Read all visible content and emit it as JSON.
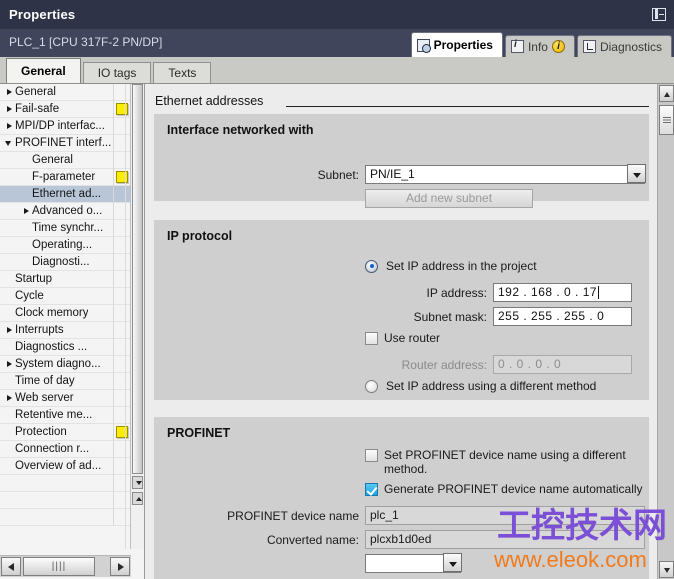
{
  "window": {
    "title": "Properties",
    "dock_icon": "dock-layout-icon"
  },
  "device_header": {
    "name": "PLC_1 [CPU 317F-2 PN/DP]"
  },
  "right_tabs": [
    {
      "label": "Properties",
      "icon": "properties-magnifier-icon",
      "active": true
    },
    {
      "label": "Info",
      "icon": "info-icon",
      "badge": "i",
      "active": false
    },
    {
      "label": "Diagnostics",
      "icon": "diagnostics-icon",
      "active": false
    }
  ],
  "sub_tabs": [
    {
      "label": "General",
      "active": true
    },
    {
      "label": "IO tags",
      "active": false
    },
    {
      "label": "Texts",
      "active": false
    }
  ],
  "tree": {
    "items": [
      {
        "label": "General",
        "indent": 0,
        "arrow": "closed",
        "flag": false,
        "selected": false
      },
      {
        "label": "Fail-safe",
        "indent": 0,
        "arrow": "closed",
        "flag": true,
        "selected": false
      },
      {
        "label": "MPI/DP interfac...",
        "indent": 0,
        "arrow": "closed",
        "flag": false,
        "selected": false
      },
      {
        "label": "PROFINET interf...",
        "indent": 0,
        "arrow": "open",
        "flag": false,
        "selected": false
      },
      {
        "label": "General",
        "indent": 1,
        "arrow": "none",
        "flag": false,
        "selected": false
      },
      {
        "label": "F-parameter",
        "indent": 1,
        "arrow": "none",
        "flag": true,
        "selected": false
      },
      {
        "label": "Ethernet ad...",
        "indent": 1,
        "arrow": "none",
        "flag": false,
        "selected": true
      },
      {
        "label": "Advanced o...",
        "indent": 1,
        "arrow": "closed",
        "flag": false,
        "selected": false
      },
      {
        "label": "Time synchr...",
        "indent": 1,
        "arrow": "none",
        "flag": false,
        "selected": false
      },
      {
        "label": "Operating...",
        "indent": 1,
        "arrow": "none",
        "flag": false,
        "selected": false
      },
      {
        "label": "Diagnosti...",
        "indent": 1,
        "arrow": "none",
        "flag": false,
        "selected": false
      },
      {
        "label": "Startup",
        "indent": 0,
        "arrow": "none",
        "flag": false,
        "selected": false
      },
      {
        "label": "Cycle",
        "indent": 0,
        "arrow": "none",
        "flag": false,
        "selected": false
      },
      {
        "label": "Clock memory",
        "indent": 0,
        "arrow": "none",
        "flag": false,
        "selected": false
      },
      {
        "label": "Interrupts",
        "indent": 0,
        "arrow": "closed",
        "flag": false,
        "selected": false
      },
      {
        "label": "Diagnostics ...",
        "indent": 0,
        "arrow": "none",
        "flag": false,
        "selected": false
      },
      {
        "label": "System diagno...",
        "indent": 0,
        "arrow": "closed",
        "flag": false,
        "selected": false
      },
      {
        "label": "Time of day",
        "indent": 0,
        "arrow": "none",
        "flag": false,
        "selected": false
      },
      {
        "label": "Web server",
        "indent": 0,
        "arrow": "closed",
        "flag": false,
        "selected": false
      },
      {
        "label": "Retentive me...",
        "indent": 0,
        "arrow": "none",
        "flag": false,
        "selected": false
      },
      {
        "label": "Protection",
        "indent": 0,
        "arrow": "none",
        "flag": true,
        "selected": false
      },
      {
        "label": "Connection r...",
        "indent": 0,
        "arrow": "none",
        "flag": false,
        "selected": false
      },
      {
        "label": "Overview of ad...",
        "indent": 0,
        "arrow": "none",
        "flag": false,
        "selected": false
      },
      {
        "label": "",
        "indent": 0,
        "arrow": "none",
        "flag": false,
        "selected": false
      },
      {
        "label": "",
        "indent": 0,
        "arrow": "none",
        "flag": false,
        "selected": false
      },
      {
        "label": "",
        "indent": 0,
        "arrow": "none",
        "flag": false,
        "selected": false
      }
    ],
    "hscroll": {
      "left_arrow": "❮",
      "right_arrow": "❯",
      "thumb_grip": "||||"
    }
  },
  "content": {
    "page_title": "Ethernet addresses",
    "interface_group": {
      "heading": "Interface networked with",
      "subnet_label": "Subnet:",
      "subnet_value": "PN/IE_1",
      "add_subnet_button": "Add new subnet"
    },
    "ip_group": {
      "heading": "IP protocol",
      "radio_set_in_project": "Set IP address in the project",
      "ip_address_label": "IP address:",
      "ip_address_value": "192 . 168 . 0     . 17",
      "subnet_mask_label": "Subnet mask:",
      "subnet_mask_value": "255 . 255 . 255 . 0",
      "use_router_label": "Use router",
      "router_address_label": "Router address:",
      "router_address_value": "0      . 0      . 0      . 0",
      "radio_different_method": "Set IP address using a different method"
    },
    "profinet_group": {
      "heading": "PROFINET",
      "chk_device_name_different": "Set PROFINET device name using a different method.",
      "chk_generate_automatically": "Generate PROFINET device name automatically",
      "device_name_label": "PROFINET device name",
      "device_name_value": "plc_1",
      "converted_name_label": "Converted name:",
      "converted_name_value": "plcxb1d0ed"
    }
  },
  "watermark": {
    "cn": "工控技术网",
    "url": "www.eleok.com"
  },
  "colors": {
    "titlebar": "#2e3347",
    "devbar": "#40455c",
    "selection": "#b8c6d8",
    "flag_yellow": "#ffed00",
    "checkbox_on": "#1aa3e8",
    "radio_dot": "#1461c8",
    "watermark_cn": "#7b4fd6",
    "watermark_url": "#f07b1e"
  }
}
